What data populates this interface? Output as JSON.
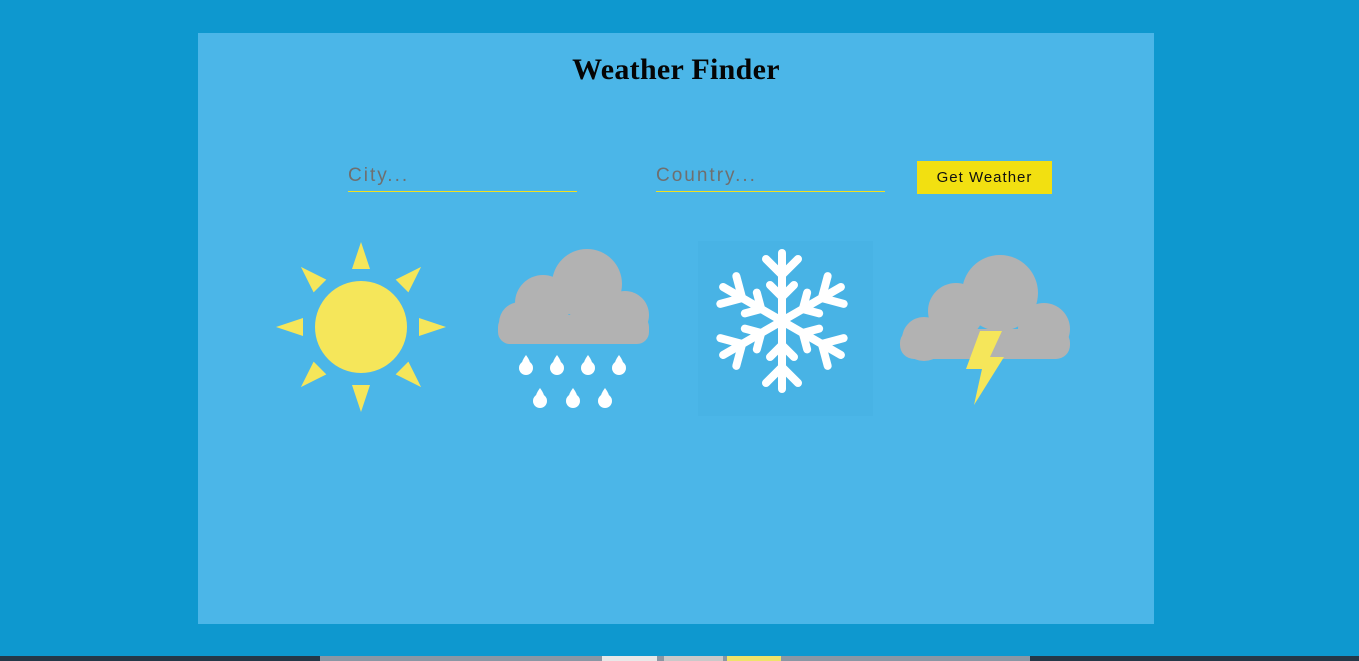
{
  "app": {
    "title": "Weather Finder"
  },
  "form": {
    "city": {
      "value": "",
      "placeholder": "City..."
    },
    "country": {
      "value": "",
      "placeholder": "Country..."
    },
    "submit_label": "Get Weather"
  },
  "icons": [
    {
      "name": "sun-icon"
    },
    {
      "name": "rain-cloud-icon"
    },
    {
      "name": "snowflake-icon"
    },
    {
      "name": "thunderstorm-icon"
    }
  ],
  "colors": {
    "page_background": "#0e98cf",
    "panel_background": "#4bb6e8",
    "accent_yellow": "#f2e011",
    "sun_yellow": "#f5e65a",
    "cloud_gray": "#b2b2b2",
    "snow_white": "#ffffff"
  }
}
